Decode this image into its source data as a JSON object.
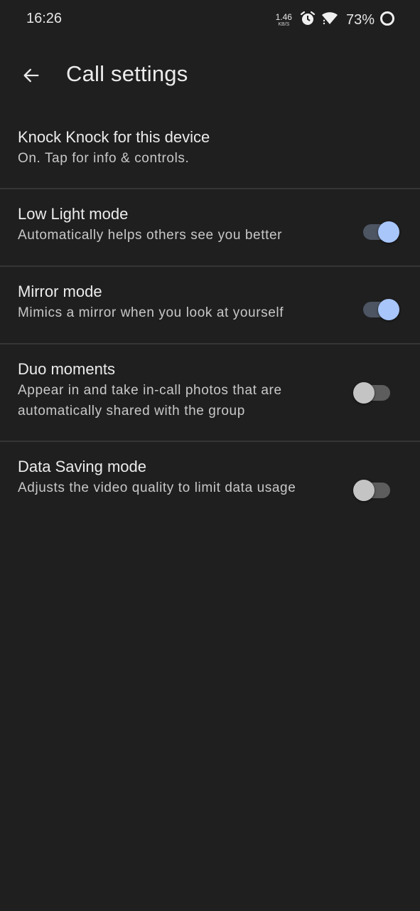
{
  "status_bar": {
    "time": "16:26",
    "net_speed_value": "1.46",
    "net_speed_unit": "KB/S",
    "battery_percent": "73%"
  },
  "app_bar": {
    "title": "Call settings"
  },
  "settings": [
    {
      "title": "Knock Knock for this device",
      "subtitle": "On. Tap for info & controls."
    },
    {
      "title": "Low Light mode",
      "subtitle": "Automatically helps others see you better",
      "toggle": "on"
    },
    {
      "title": "Mirror mode",
      "subtitle": "Mimics a mirror when you look at yourself",
      "toggle": "on"
    },
    {
      "title": "Duo moments",
      "subtitle": "Appear in and take in-call photos that are automatically shared with the group",
      "toggle": "off"
    },
    {
      "title": "Data Saving mode",
      "subtitle": "Adjusts the video quality to limit data usage",
      "toggle": "off"
    }
  ],
  "colors": {
    "background": "#1f1f1f",
    "toggle_on_thumb": "#a8c6fa",
    "toggle_on_track": "#4d5563",
    "toggle_off_thumb": "#c4c4c4",
    "toggle_off_track": "#5d5d5d"
  }
}
